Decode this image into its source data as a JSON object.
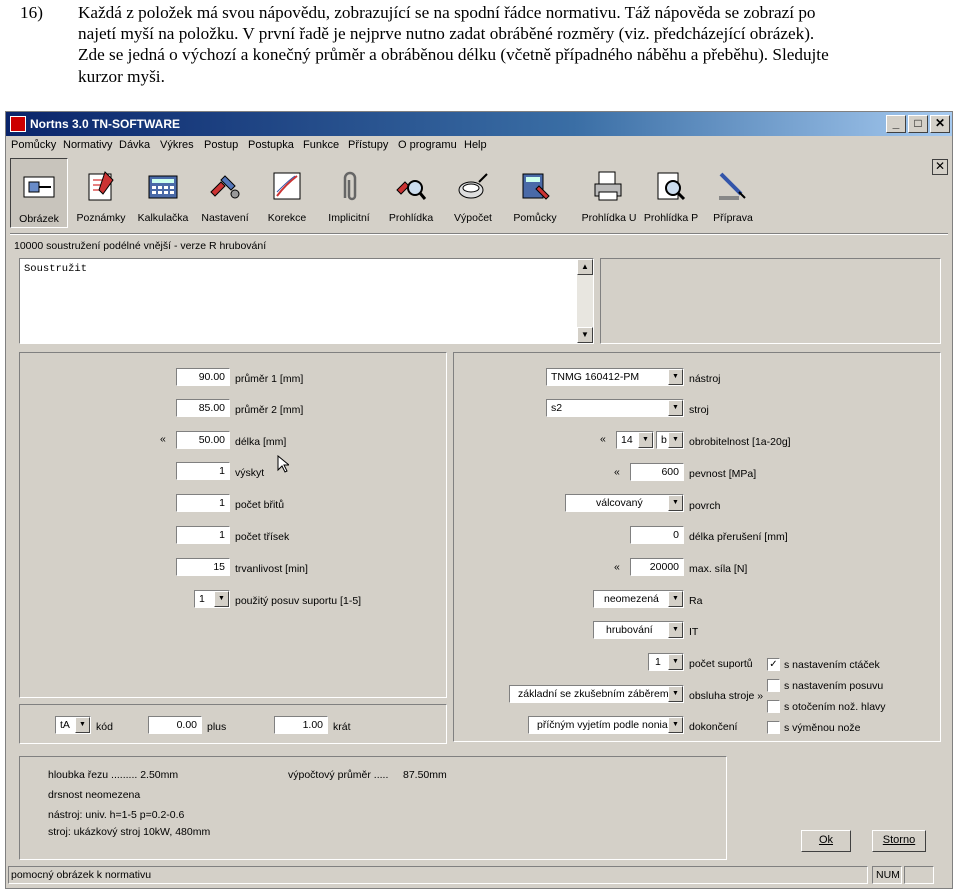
{
  "doc": {
    "number": "16)",
    "lines": [
      "Každá z položek má svou nápovědu, zobrazující se na spodní řádce normativu. Táž nápověda se zobrazí po",
      "najetí myší na položku. V první řadě je nejprve nutno zadat obráběné rozměry (viz. předcházející obrázek).",
      "Zde se jedná o výchozí a konečný průměr a obráběnou délku (včetně případného náběhu a přeběhu). Sledujte",
      "kurzor myši."
    ]
  },
  "window": {
    "title": "Nortns 3.0 TN-SOFTWARE",
    "min_label": "_",
    "max_label": "□",
    "close_label": "✕"
  },
  "menu": [
    "Pomůcky",
    "Normativy",
    "Dávka",
    "Výkres",
    "Postup",
    "Postupka",
    "Funkce",
    "Přístupy",
    "O programu",
    "Help"
  ],
  "toolbar": [
    "Obrázek",
    "Poznámky",
    "Kalkulačka",
    "Nastavení",
    "Korekce",
    "Implicitní",
    "Prohlídka",
    "Výpočet",
    "Pomůcky",
    "Prohlídka U",
    "Prohlídka P",
    "Příprava"
  ],
  "subtitle": "10000 soustružení podélné vnější - verze R hrubování",
  "memo_text": "Soustružit",
  "left": {
    "prumer1": {
      "value": "90.00",
      "label": "průměr 1 [mm]"
    },
    "prumer2": {
      "value": "85.00",
      "label": "průměr 2 [mm]"
    },
    "delka": {
      "arrow": "«",
      "value": "50.00",
      "label": "délka [mm]"
    },
    "vyskyt": {
      "value": "1",
      "label": "výskyt"
    },
    "brity": {
      "value": "1",
      "label": "počet břitů"
    },
    "trisky": {
      "value": "1",
      "label": "počet třísek"
    },
    "trvanlivost": {
      "value": "15",
      "label": "trvanlivost [min]"
    },
    "posuv": {
      "value": "1",
      "label": "použitý posuv suportu [1-5]"
    }
  },
  "right": {
    "nastroj": {
      "value": "TNMG 160412-PM",
      "label": "nástroj"
    },
    "stroj": {
      "value": "s2",
      "label": "stroj"
    },
    "obrobitelnost": {
      "arrow": "«",
      "v1": "14",
      "v2": "b",
      "label": "obrobitelnost [1a-20g]"
    },
    "pevnost": {
      "arrow": "«",
      "value": "600",
      "label": "pevnost [MPa]"
    },
    "povrch": {
      "value": "válcovaný",
      "label": "povrch"
    },
    "preruseni": {
      "value": "0",
      "label": "délka přerušení [mm]"
    },
    "sila": {
      "arrow": "«",
      "value": "20000",
      "label": "max. síla [N]"
    },
    "ra": {
      "value": "neomezená",
      "label": "Ra"
    },
    "it": {
      "value": "hrubování",
      "label": "IT"
    },
    "suporty": {
      "value": "1",
      "label": "počet suportů"
    },
    "obsluha": {
      "value": "základní se zkušebním záběrem",
      "label": "obsluha stroje »"
    },
    "dokonceni": {
      "value": "příčným vyjetím podle nonia",
      "label": "dokončení"
    }
  },
  "checks": [
    {
      "label": "s nastavením ctáček",
      "checked": true
    },
    {
      "label": "s nastavením posuvu",
      "checked": false
    },
    {
      "label": "s otočením nož. hlavy",
      "checked": false
    },
    {
      "label": "s výměnou nože",
      "checked": false
    }
  ],
  "bottom": {
    "kod_value": "tA",
    "kod_label": "kód",
    "plus_value": "0.00",
    "plus_label": "plus",
    "krat_value": "1.00",
    "krat_label": "krát"
  },
  "info": {
    "line1": "hloubka řezu ......... 2.50mm",
    "line1b": "výpočtový průměr .....",
    "line1c": "87.50mm",
    "line2": "drsnost neomezena",
    "line3": "nástroj: univ. h=1-5 p=0.2-0.6",
    "line4": "stroj: ukázkový stroj 10kW, 480mm"
  },
  "buttons": {
    "ok": "Ok",
    "storno": "Storno"
  },
  "status": {
    "hint": "pomocný obrázek k normativu",
    "num": "NUM"
  }
}
